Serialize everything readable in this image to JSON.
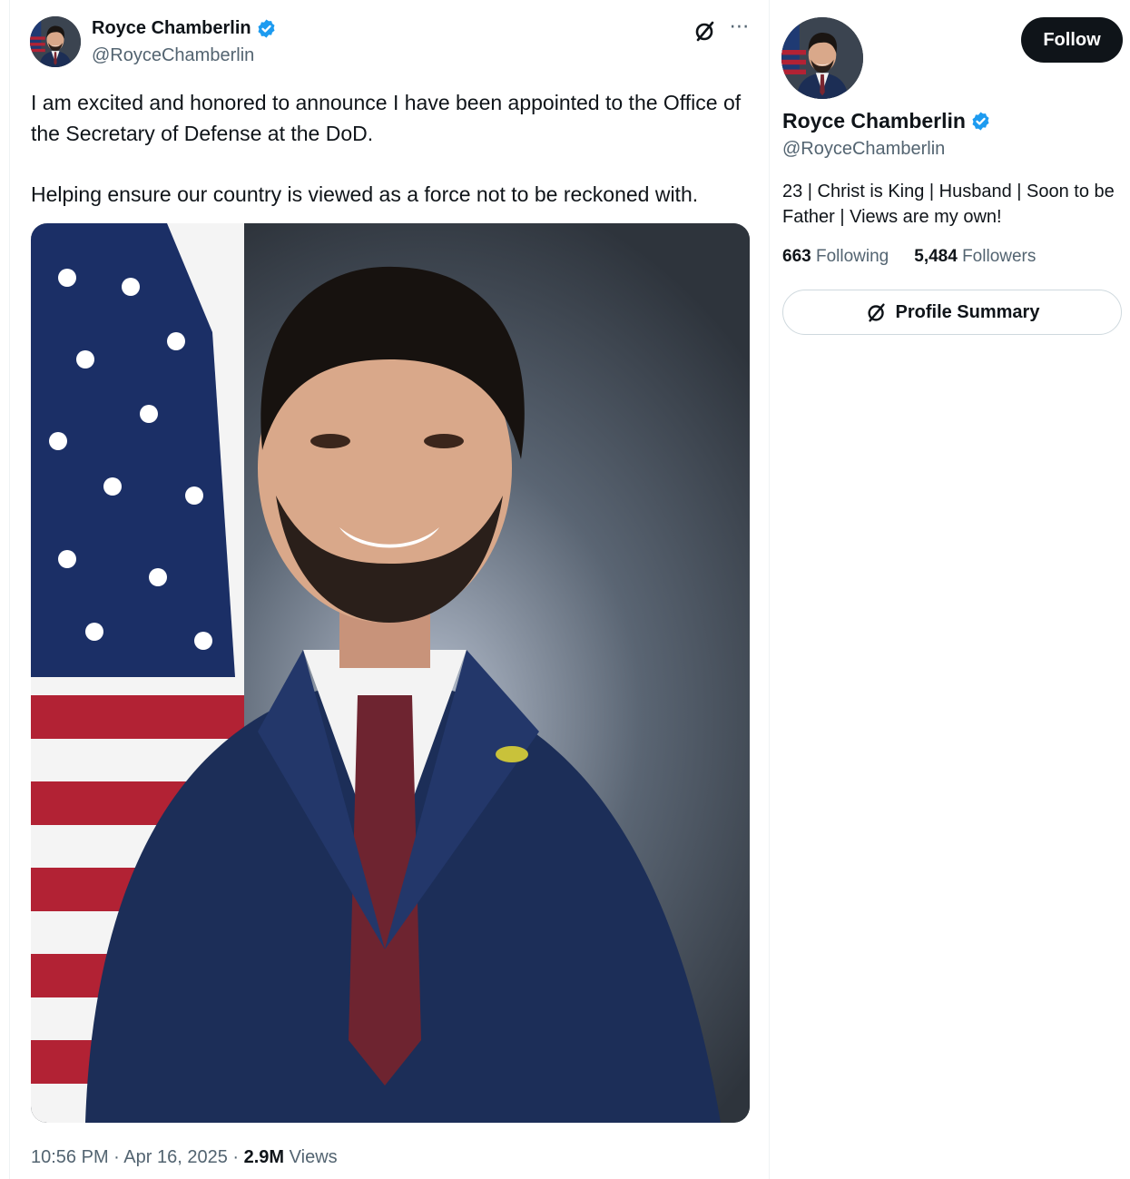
{
  "post": {
    "author": {
      "name": "Royce Chamberlin",
      "handle": "@RoyceChamberlin",
      "verified": true
    },
    "text": [
      "I am excited and honored to announce I have been appointed to the Office of the Secretary of Defense at the DoD.",
      "Helping ensure our country is viewed as a force not to be reckoned with."
    ],
    "media": {
      "description_icon": "portrait-photo"
    },
    "time": "10:56 PM",
    "date": "Apr 16, 2025",
    "separator": "·",
    "views_count": "2.9M",
    "views_label": "Views",
    "icons": {
      "grok": "grok-icon",
      "more": "more-icon"
    }
  },
  "sidebar": {
    "follow_label": "Follow",
    "name": "Royce Chamberlin",
    "handle": "@RoyceChamberlin",
    "bio": "23 | Christ is King | Husband | Soon to be Father | Views are my own!",
    "following_count": "663",
    "following_label": "Following",
    "followers_count": "5,484",
    "followers_label": "Followers",
    "summary_label": "Profile Summary"
  },
  "colors": {
    "verified": "#1d9bf0",
    "text": "#0f1419",
    "muted": "#536471",
    "follow_bg": "#0f1419"
  }
}
